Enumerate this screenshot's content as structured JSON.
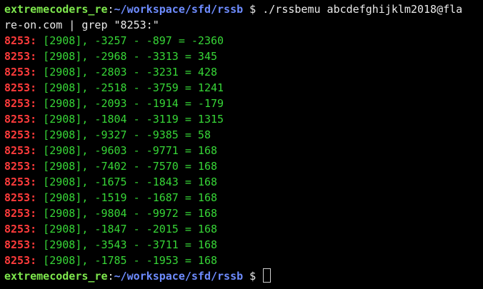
{
  "colors": {
    "background": "#000000",
    "prompt_user": "#7ee84d",
    "prompt_path": "#6e8cff",
    "text": "#eaeaea",
    "grep_match": "#ff3b3b",
    "output": "#37d637"
  },
  "prompt": {
    "user_host": "extremecoders_re",
    "colon": ":",
    "path": "~/workspace/sfd/rssb",
    "symbol": " $ "
  },
  "command": {
    "line1": "./rssbemu abcdefghijklm2018@fla",
    "line2": "re-on.com | grep \"8253:\""
  },
  "output": {
    "match_label": "8253:",
    "rows": [
      " [2908], -3257 - -897 = -2360",
      " [2908], -2968 - -3313 = 345",
      " [2908], -2803 - -3231 = 428",
      " [2908], -2518 - -3759 = 1241",
      " [2908], -2093 - -1914 = -179",
      " [2908], -1804 - -3119 = 1315",
      " [2908], -9327 - -9385 = 58",
      " [2908], -9603 - -9771 = 168",
      " [2908], -7402 - -7570 = 168",
      " [2908], -1675 - -1843 = 168",
      " [2908], -1519 - -1687 = 168",
      " [2908], -9804 - -9972 = 168",
      " [2908], -1847 - -2015 = 168",
      " [2908], -3543 - -3711 = 168",
      " [2908], -1785 - -1953 = 168"
    ]
  }
}
